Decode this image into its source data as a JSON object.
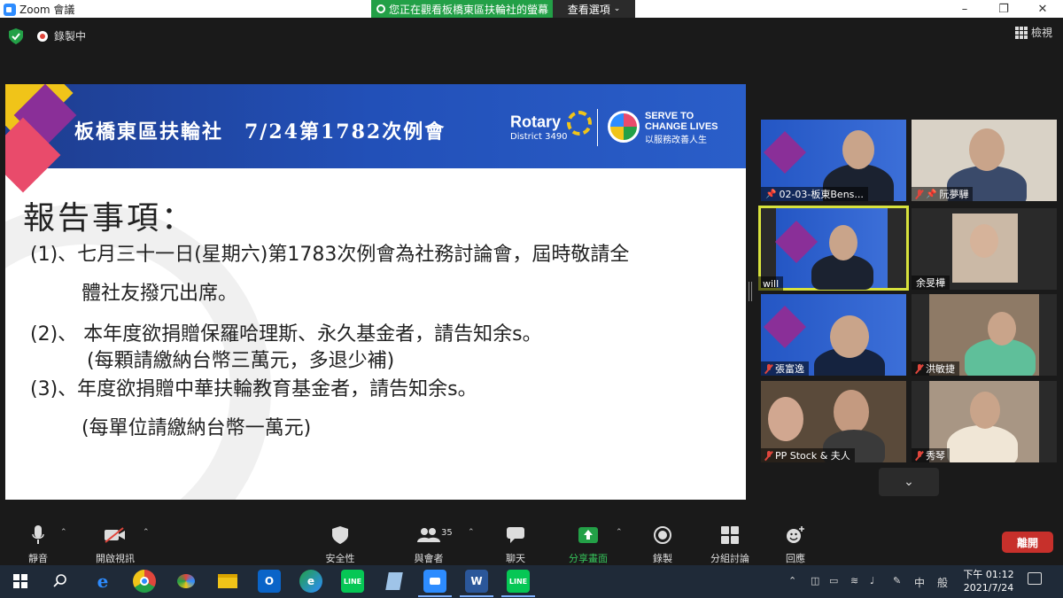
{
  "window": {
    "title": "Zoom 會議",
    "share_banner": "您正在觀看板橋東區扶輪社的螢幕",
    "view_options": "查看選項"
  },
  "topbar": {
    "recording_label": "錄製中",
    "view_label": "檢視"
  },
  "slide": {
    "title": "板橋東區扶輪社　7/24第1782次例會",
    "rotary": "Rotary",
    "district": "District 3490",
    "serve_line1": "SERVE TO",
    "serve_line2": "CHANGE LIVES",
    "serve_line3": "以服務改善人生",
    "heading": "報告事項：",
    "lines": [
      "(1)、七月三十一日(星期六)第1783次例會為社務討論會，屆時敬請全",
      "體社友撥冗出席。",
      "(2)、 本年度欲捐贈保羅哈理斯、永久基金者，請告知余s。",
      "(每顆請繳納台幣三萬元，多退少補)",
      "(3)、年度欲捐贈中華扶輪教育基金者，請告知余s。",
      "(每單位請繳納台幣一萬元)"
    ]
  },
  "participants": [
    {
      "name": "02-03-板東Bens...",
      "muted": false,
      "pinned": true
    },
    {
      "name": "阮夢驊",
      "muted": true,
      "pinned": true
    },
    {
      "name": "will",
      "muted": false,
      "pinned": false,
      "active": true
    },
    {
      "name": "余旻樺",
      "muted": false,
      "pinned": false
    },
    {
      "name": "張富逸",
      "muted": true,
      "pinned": false
    },
    {
      "name": "洪敏捷",
      "muted": true,
      "pinned": false
    },
    {
      "name": "PP Stock & 夫人",
      "muted": true,
      "pinned": false
    },
    {
      "name": "秀琴",
      "muted": true,
      "pinned": false
    }
  ],
  "toolbar": {
    "mute": "靜音",
    "video": "開啟視訊",
    "security": "安全性",
    "participants": "與會者",
    "participants_count": "35",
    "chat": "聊天",
    "share": "分享畫面",
    "record": "錄製",
    "breakout": "分組討論",
    "reactions": "回應",
    "leave": "離開"
  },
  "taskbar": {
    "time": "下午 01:12",
    "date": "2021/7/24",
    "ime": "中",
    "ime2": "般"
  },
  "colors": {
    "share_green": "#23a047",
    "leave_red": "#c7302b",
    "active_speaker": "#d8e23c",
    "slide_header_blue": "#2250b8"
  }
}
